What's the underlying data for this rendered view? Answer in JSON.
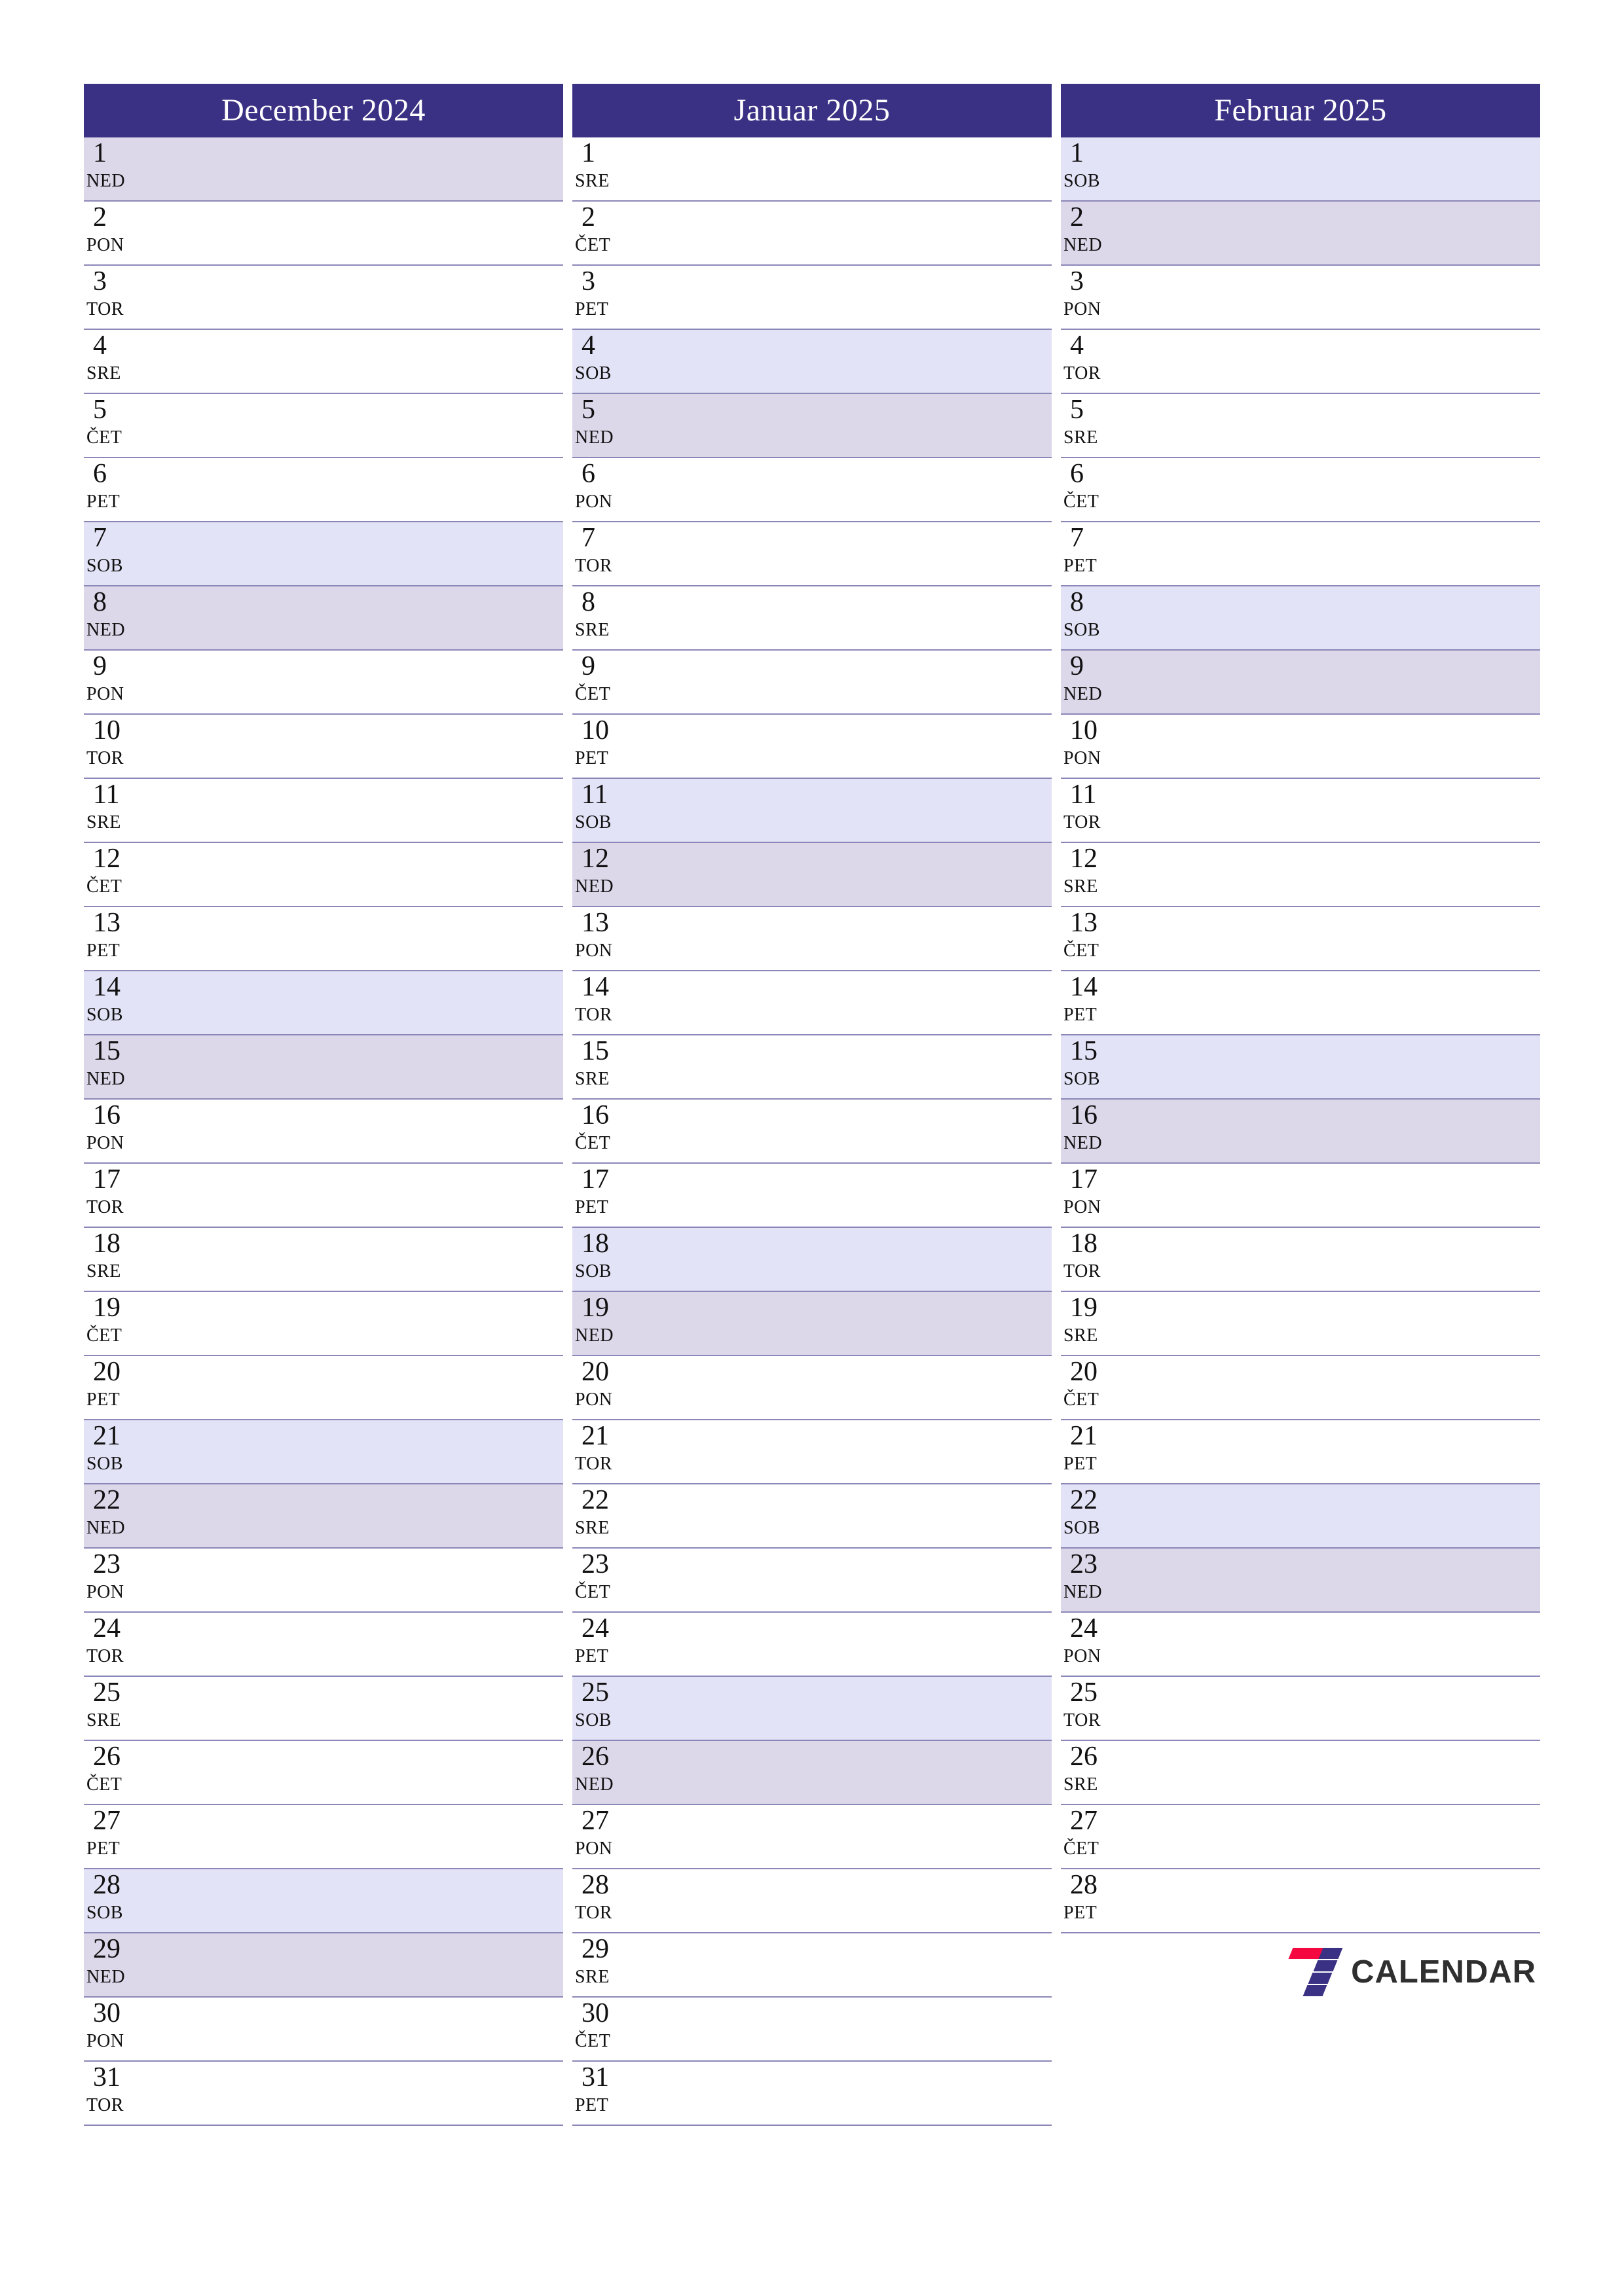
{
  "colors": {
    "header_bg": "#3a3185",
    "header_text": "#ffffff",
    "saturday_bg": "#e3e3f7",
    "sunday_bg": "#dcd8ea",
    "row_divider": "#8b87b8",
    "logo_red": "#f5083f",
    "logo_indigo": "#3a3185",
    "logo_text": "#2f2f2f"
  },
  "brand": {
    "name": "CALENDAR",
    "mark": "seven-logo-icon"
  },
  "months": [
    {
      "title": "December 2024",
      "days": [
        {
          "num": "1",
          "abbr": "NED",
          "type": "sun"
        },
        {
          "num": "2",
          "abbr": "PON",
          "type": "weekday"
        },
        {
          "num": "3",
          "abbr": "TOR",
          "type": "weekday"
        },
        {
          "num": "4",
          "abbr": "SRE",
          "type": "weekday"
        },
        {
          "num": "5",
          "abbr": "ČET",
          "type": "weekday"
        },
        {
          "num": "6",
          "abbr": "PET",
          "type": "weekday"
        },
        {
          "num": "7",
          "abbr": "SOB",
          "type": "sat"
        },
        {
          "num": "8",
          "abbr": "NED",
          "type": "sun"
        },
        {
          "num": "9",
          "abbr": "PON",
          "type": "weekday"
        },
        {
          "num": "10",
          "abbr": "TOR",
          "type": "weekday"
        },
        {
          "num": "11",
          "abbr": "SRE",
          "type": "weekday"
        },
        {
          "num": "12",
          "abbr": "ČET",
          "type": "weekday"
        },
        {
          "num": "13",
          "abbr": "PET",
          "type": "weekday"
        },
        {
          "num": "14",
          "abbr": "SOB",
          "type": "sat"
        },
        {
          "num": "15",
          "abbr": "NED",
          "type": "sun"
        },
        {
          "num": "16",
          "abbr": "PON",
          "type": "weekday"
        },
        {
          "num": "17",
          "abbr": "TOR",
          "type": "weekday"
        },
        {
          "num": "18",
          "abbr": "SRE",
          "type": "weekday"
        },
        {
          "num": "19",
          "abbr": "ČET",
          "type": "weekday"
        },
        {
          "num": "20",
          "abbr": "PET",
          "type": "weekday"
        },
        {
          "num": "21",
          "abbr": "SOB",
          "type": "sat"
        },
        {
          "num": "22",
          "abbr": "NED",
          "type": "sun"
        },
        {
          "num": "23",
          "abbr": "PON",
          "type": "weekday"
        },
        {
          "num": "24",
          "abbr": "TOR",
          "type": "weekday"
        },
        {
          "num": "25",
          "abbr": "SRE",
          "type": "weekday"
        },
        {
          "num": "26",
          "abbr": "ČET",
          "type": "weekday"
        },
        {
          "num": "27",
          "abbr": "PET",
          "type": "weekday"
        },
        {
          "num": "28",
          "abbr": "SOB",
          "type": "sat"
        },
        {
          "num": "29",
          "abbr": "NED",
          "type": "sun"
        },
        {
          "num": "30",
          "abbr": "PON",
          "type": "weekday"
        },
        {
          "num": "31",
          "abbr": "TOR",
          "type": "weekday"
        }
      ]
    },
    {
      "title": "Januar 2025",
      "days": [
        {
          "num": "1",
          "abbr": "SRE",
          "type": "weekday"
        },
        {
          "num": "2",
          "abbr": "ČET",
          "type": "weekday"
        },
        {
          "num": "3",
          "abbr": "PET",
          "type": "weekday"
        },
        {
          "num": "4",
          "abbr": "SOB",
          "type": "sat"
        },
        {
          "num": "5",
          "abbr": "NED",
          "type": "sun"
        },
        {
          "num": "6",
          "abbr": "PON",
          "type": "weekday"
        },
        {
          "num": "7",
          "abbr": "TOR",
          "type": "weekday"
        },
        {
          "num": "8",
          "abbr": "SRE",
          "type": "weekday"
        },
        {
          "num": "9",
          "abbr": "ČET",
          "type": "weekday"
        },
        {
          "num": "10",
          "abbr": "PET",
          "type": "weekday"
        },
        {
          "num": "11",
          "abbr": "SOB",
          "type": "sat"
        },
        {
          "num": "12",
          "abbr": "NED",
          "type": "sun"
        },
        {
          "num": "13",
          "abbr": "PON",
          "type": "weekday"
        },
        {
          "num": "14",
          "abbr": "TOR",
          "type": "weekday"
        },
        {
          "num": "15",
          "abbr": "SRE",
          "type": "weekday"
        },
        {
          "num": "16",
          "abbr": "ČET",
          "type": "weekday"
        },
        {
          "num": "17",
          "abbr": "PET",
          "type": "weekday"
        },
        {
          "num": "18",
          "abbr": "SOB",
          "type": "sat"
        },
        {
          "num": "19",
          "abbr": "NED",
          "type": "sun"
        },
        {
          "num": "20",
          "abbr": "PON",
          "type": "weekday"
        },
        {
          "num": "21",
          "abbr": "TOR",
          "type": "weekday"
        },
        {
          "num": "22",
          "abbr": "SRE",
          "type": "weekday"
        },
        {
          "num": "23",
          "abbr": "ČET",
          "type": "weekday"
        },
        {
          "num": "24",
          "abbr": "PET",
          "type": "weekday"
        },
        {
          "num": "25",
          "abbr": "SOB",
          "type": "sat"
        },
        {
          "num": "26",
          "abbr": "NED",
          "type": "sun"
        },
        {
          "num": "27",
          "abbr": "PON",
          "type": "weekday"
        },
        {
          "num": "28",
          "abbr": "TOR",
          "type": "weekday"
        },
        {
          "num": "29",
          "abbr": "SRE",
          "type": "weekday"
        },
        {
          "num": "30",
          "abbr": "ČET",
          "type": "weekday"
        },
        {
          "num": "31",
          "abbr": "PET",
          "type": "weekday"
        }
      ]
    },
    {
      "title": "Februar 2025",
      "days": [
        {
          "num": "1",
          "abbr": "SOB",
          "type": "sat"
        },
        {
          "num": "2",
          "abbr": "NED",
          "type": "sun"
        },
        {
          "num": "3",
          "abbr": "PON",
          "type": "weekday"
        },
        {
          "num": "4",
          "abbr": "TOR",
          "type": "weekday"
        },
        {
          "num": "5",
          "abbr": "SRE",
          "type": "weekday"
        },
        {
          "num": "6",
          "abbr": "ČET",
          "type": "weekday"
        },
        {
          "num": "7",
          "abbr": "PET",
          "type": "weekday"
        },
        {
          "num": "8",
          "abbr": "SOB",
          "type": "sat"
        },
        {
          "num": "9",
          "abbr": "NED",
          "type": "sun"
        },
        {
          "num": "10",
          "abbr": "PON",
          "type": "weekday"
        },
        {
          "num": "11",
          "abbr": "TOR",
          "type": "weekday"
        },
        {
          "num": "12",
          "abbr": "SRE",
          "type": "weekday"
        },
        {
          "num": "13",
          "abbr": "ČET",
          "type": "weekday"
        },
        {
          "num": "14",
          "abbr": "PET",
          "type": "weekday"
        },
        {
          "num": "15",
          "abbr": "SOB",
          "type": "sat"
        },
        {
          "num": "16",
          "abbr": "NED",
          "type": "sun"
        },
        {
          "num": "17",
          "abbr": "PON",
          "type": "weekday"
        },
        {
          "num": "18",
          "abbr": "TOR",
          "type": "weekday"
        },
        {
          "num": "19",
          "abbr": "SRE",
          "type": "weekday"
        },
        {
          "num": "20",
          "abbr": "ČET",
          "type": "weekday"
        },
        {
          "num": "21",
          "abbr": "PET",
          "type": "weekday"
        },
        {
          "num": "22",
          "abbr": "SOB",
          "type": "sat"
        },
        {
          "num": "23",
          "abbr": "NED",
          "type": "sun"
        },
        {
          "num": "24",
          "abbr": "PON",
          "type": "weekday"
        },
        {
          "num": "25",
          "abbr": "TOR",
          "type": "weekday"
        },
        {
          "num": "26",
          "abbr": "SRE",
          "type": "weekday"
        },
        {
          "num": "27",
          "abbr": "ČET",
          "type": "weekday"
        },
        {
          "num": "28",
          "abbr": "PET",
          "type": "weekday"
        }
      ]
    }
  ]
}
